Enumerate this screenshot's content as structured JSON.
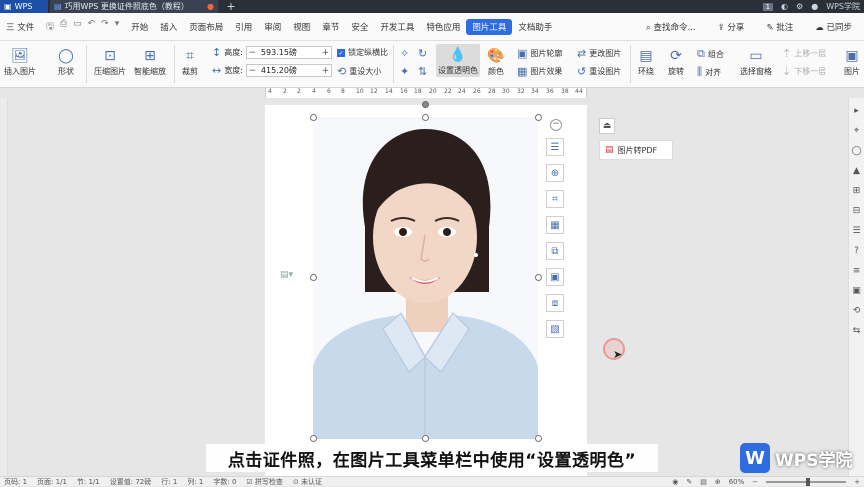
{
  "titlebar": {
    "app_label": "WPS",
    "doc_tab": "巧用WPS 更换证件照底色（教程）",
    "add_tab": "+",
    "page_badge": "1",
    "account": "WPS学院"
  },
  "menubar": {
    "file": "三 文件",
    "items": [
      "开始",
      "插入",
      "页面布局",
      "引用",
      "审阅",
      "视图",
      "章节",
      "安全",
      "开发工具",
      "特色应用",
      "图片工具",
      "文档助手"
    ],
    "active_item": "图片工具",
    "search": "查找命令...",
    "share": "分享",
    "comment": "批注",
    "sync": "已同步"
  },
  "ribbon": {
    "insert_picture": "插入图片",
    "shape": "形状",
    "compress": "压缩图片",
    "smart_zoom": "智能缩放",
    "crop": "裁剪",
    "height_label": "高度:",
    "height_value": "593.15磅",
    "width_label": "宽度:",
    "width_value": "415.20磅",
    "lock_ratio": "锁定纵横比",
    "reset_size": "重设大小",
    "set_transparent": "设置透明色",
    "color": "颜色",
    "outline": "图片轮廓",
    "effect": "图片效果",
    "change_picture": "更改图片",
    "reset_picture": "重设图片",
    "wrap": "环绕",
    "rotate": "旋转",
    "group": "组合",
    "align": "对齐",
    "selection_pane": "选择窗格",
    "bring_forward": "上移一层",
    "send_backward": "下移一层",
    "more": "图片"
  },
  "ruler": {
    "ticks": [
      "4",
      "2",
      "2",
      "4",
      "6",
      "8",
      "10",
      "12",
      "14",
      "16",
      "18",
      "20",
      "22",
      "24",
      "26",
      "28",
      "30",
      "32",
      "34",
      "36",
      "38",
      "44"
    ]
  },
  "side_panel": {
    "to_pdf": "图片转PDF"
  },
  "subtitle": "点击证件照，在图片工具菜单栏中使用“设置透明色”",
  "watermark": "WPS学院",
  "status": {
    "page_num": "页码: 1",
    "pages": "页面: 1/1",
    "section": "节: 1/1",
    "setting": "设置值: 72磅",
    "row": "行: 1",
    "col": "列: 1",
    "words": "字数: 0",
    "spell": "拼写检查",
    "cert": "未认证",
    "zoom": "60%"
  },
  "colors": {
    "accent": "#2f6ce0",
    "titlebar": "#2b2f38",
    "shirt": "#c9d9ec"
  }
}
